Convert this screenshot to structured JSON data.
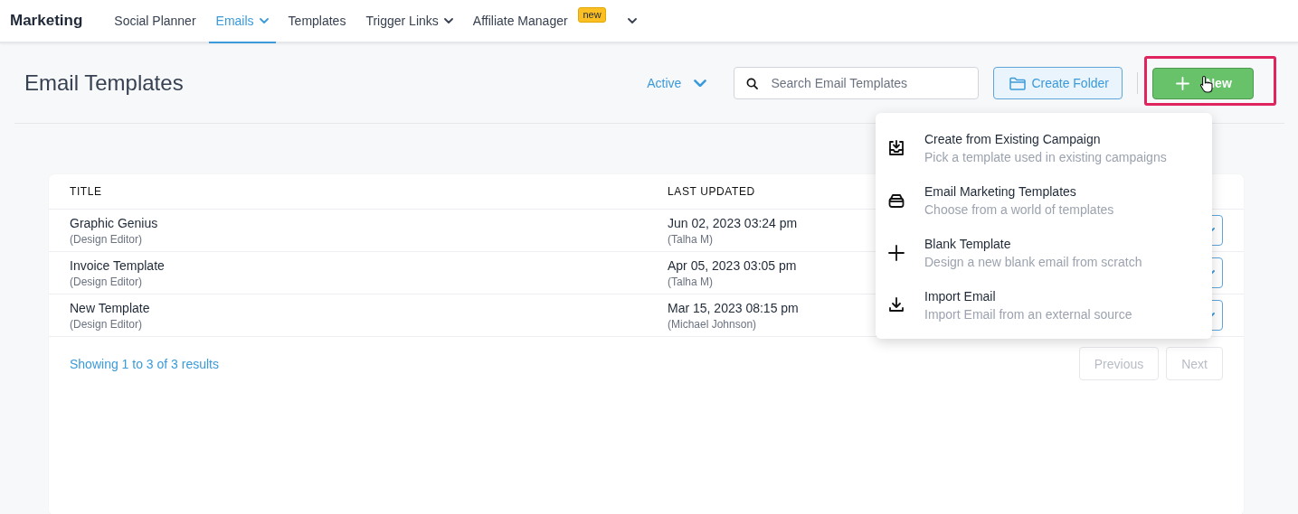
{
  "nav": {
    "brand": "Marketing",
    "items": [
      {
        "label": "Social Planner",
        "selected": false,
        "caret": false
      },
      {
        "label": "Emails",
        "selected": true,
        "caret": true
      },
      {
        "label": "Templates",
        "selected": false,
        "caret": false
      },
      {
        "label": "Trigger Links",
        "selected": false,
        "caret": true
      },
      {
        "label": "Affiliate Manager",
        "selected": false,
        "caret": false,
        "badge": "new"
      }
    ]
  },
  "header": {
    "title": "Email Templates",
    "status_filter": "Active",
    "search": {
      "placeholder": "Search Email Templates"
    },
    "create_folder": "Create Folder",
    "new_button": "New"
  },
  "new_menu": [
    {
      "kind": "campaign",
      "title": "Create from Existing Campaign",
      "description": "Pick a template used in existing campaigns"
    },
    {
      "kind": "library",
      "title": "Email Marketing Templates",
      "description": "Choose from a world of templates"
    },
    {
      "kind": "blank",
      "title": "Blank Template",
      "description": "Design a new blank email from scratch"
    },
    {
      "kind": "import",
      "title": "Import Email",
      "description": "Import Email from an external source"
    }
  ],
  "table": {
    "columns": [
      "TITLE",
      "LAST UPDATED"
    ],
    "rows": [
      {
        "title": "Graphic Genius",
        "editor": "(Design Editor)",
        "updated": "Jun 02, 2023 03:24 pm",
        "author": "(Talha M)"
      },
      {
        "title": "Invoice Template",
        "editor": "(Design Editor)",
        "updated": "Apr 05, 2023 03:05 pm",
        "author": "(Talha M)"
      },
      {
        "title": "New Template",
        "editor": "(Design Editor)",
        "updated": "Mar 15, 2023 08:15 pm",
        "author": "(Michael Johnson)"
      }
    ],
    "summary": "Showing 1 to 3 of 3 results",
    "pagination": [
      {
        "label": "Previous",
        "disabled": true
      },
      {
        "label": "Next",
        "disabled": true
      }
    ]
  }
}
